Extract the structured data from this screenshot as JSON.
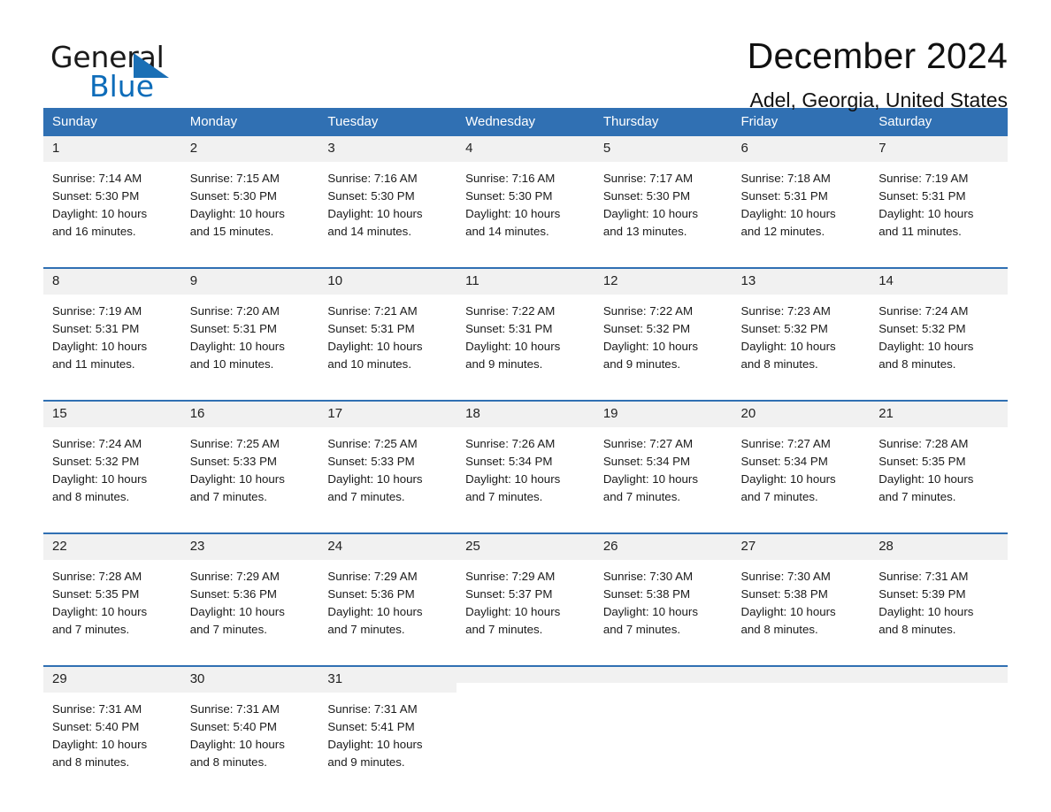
{
  "brand": {
    "word_one": "General",
    "word_two": "Blue",
    "triangle_color": "#1a6fb5",
    "blue_color": "#0d6cb9"
  },
  "header": {
    "title": "December 2024",
    "subtitle": "Adel, Georgia, United States",
    "accent_color": "#3070b3",
    "daynum_background": "#f1f1f1"
  },
  "calendar": {
    "weekday_headers": [
      "Sunday",
      "Monday",
      "Tuesday",
      "Wednesday",
      "Thursday",
      "Friday",
      "Saturday"
    ],
    "weeks": [
      [
        {
          "day": "1",
          "sunrise": "Sunrise: 7:14 AM",
          "sunset": "Sunset: 5:30 PM",
          "daylight_line1": "Daylight: 10 hours",
          "daylight_line2": "and 16 minutes."
        },
        {
          "day": "2",
          "sunrise": "Sunrise: 7:15 AM",
          "sunset": "Sunset: 5:30 PM",
          "daylight_line1": "Daylight: 10 hours",
          "daylight_line2": "and 15 minutes."
        },
        {
          "day": "3",
          "sunrise": "Sunrise: 7:16 AM",
          "sunset": "Sunset: 5:30 PM",
          "daylight_line1": "Daylight: 10 hours",
          "daylight_line2": "and 14 minutes."
        },
        {
          "day": "4",
          "sunrise": "Sunrise: 7:16 AM",
          "sunset": "Sunset: 5:30 PM",
          "daylight_line1": "Daylight: 10 hours",
          "daylight_line2": "and 14 minutes."
        },
        {
          "day": "5",
          "sunrise": "Sunrise: 7:17 AM",
          "sunset": "Sunset: 5:30 PM",
          "daylight_line1": "Daylight: 10 hours",
          "daylight_line2": "and 13 minutes."
        },
        {
          "day": "6",
          "sunrise": "Sunrise: 7:18 AM",
          "sunset": "Sunset: 5:31 PM",
          "daylight_line1": "Daylight: 10 hours",
          "daylight_line2": "and 12 minutes."
        },
        {
          "day": "7",
          "sunrise": "Sunrise: 7:19 AM",
          "sunset": "Sunset: 5:31 PM",
          "daylight_line1": "Daylight: 10 hours",
          "daylight_line2": "and 11 minutes."
        }
      ],
      [
        {
          "day": "8",
          "sunrise": "Sunrise: 7:19 AM",
          "sunset": "Sunset: 5:31 PM",
          "daylight_line1": "Daylight: 10 hours",
          "daylight_line2": "and 11 minutes."
        },
        {
          "day": "9",
          "sunrise": "Sunrise: 7:20 AM",
          "sunset": "Sunset: 5:31 PM",
          "daylight_line1": "Daylight: 10 hours",
          "daylight_line2": "and 10 minutes."
        },
        {
          "day": "10",
          "sunrise": "Sunrise: 7:21 AM",
          "sunset": "Sunset: 5:31 PM",
          "daylight_line1": "Daylight: 10 hours",
          "daylight_line2": "and 10 minutes."
        },
        {
          "day": "11",
          "sunrise": "Sunrise: 7:22 AM",
          "sunset": "Sunset: 5:31 PM",
          "daylight_line1": "Daylight: 10 hours",
          "daylight_line2": "and 9 minutes."
        },
        {
          "day": "12",
          "sunrise": "Sunrise: 7:22 AM",
          "sunset": "Sunset: 5:32 PM",
          "daylight_line1": "Daylight: 10 hours",
          "daylight_line2": "and 9 minutes."
        },
        {
          "day": "13",
          "sunrise": "Sunrise: 7:23 AM",
          "sunset": "Sunset: 5:32 PM",
          "daylight_line1": "Daylight: 10 hours",
          "daylight_line2": "and 8 minutes."
        },
        {
          "day": "14",
          "sunrise": "Sunrise: 7:24 AM",
          "sunset": "Sunset: 5:32 PM",
          "daylight_line1": "Daylight: 10 hours",
          "daylight_line2": "and 8 minutes."
        }
      ],
      [
        {
          "day": "15",
          "sunrise": "Sunrise: 7:24 AM",
          "sunset": "Sunset: 5:32 PM",
          "daylight_line1": "Daylight: 10 hours",
          "daylight_line2": "and 8 minutes."
        },
        {
          "day": "16",
          "sunrise": "Sunrise: 7:25 AM",
          "sunset": "Sunset: 5:33 PM",
          "daylight_line1": "Daylight: 10 hours",
          "daylight_line2": "and 7 minutes."
        },
        {
          "day": "17",
          "sunrise": "Sunrise: 7:25 AM",
          "sunset": "Sunset: 5:33 PM",
          "daylight_line1": "Daylight: 10 hours",
          "daylight_line2": "and 7 minutes."
        },
        {
          "day": "18",
          "sunrise": "Sunrise: 7:26 AM",
          "sunset": "Sunset: 5:34 PM",
          "daylight_line1": "Daylight: 10 hours",
          "daylight_line2": "and 7 minutes."
        },
        {
          "day": "19",
          "sunrise": "Sunrise: 7:27 AM",
          "sunset": "Sunset: 5:34 PM",
          "daylight_line1": "Daylight: 10 hours",
          "daylight_line2": "and 7 minutes."
        },
        {
          "day": "20",
          "sunrise": "Sunrise: 7:27 AM",
          "sunset": "Sunset: 5:34 PM",
          "daylight_line1": "Daylight: 10 hours",
          "daylight_line2": "and 7 minutes."
        },
        {
          "day": "21",
          "sunrise": "Sunrise: 7:28 AM",
          "sunset": "Sunset: 5:35 PM",
          "daylight_line1": "Daylight: 10 hours",
          "daylight_line2": "and 7 minutes."
        }
      ],
      [
        {
          "day": "22",
          "sunrise": "Sunrise: 7:28 AM",
          "sunset": "Sunset: 5:35 PM",
          "daylight_line1": "Daylight: 10 hours",
          "daylight_line2": "and 7 minutes."
        },
        {
          "day": "23",
          "sunrise": "Sunrise: 7:29 AM",
          "sunset": "Sunset: 5:36 PM",
          "daylight_line1": "Daylight: 10 hours",
          "daylight_line2": "and 7 minutes."
        },
        {
          "day": "24",
          "sunrise": "Sunrise: 7:29 AM",
          "sunset": "Sunset: 5:36 PM",
          "daylight_line1": "Daylight: 10 hours",
          "daylight_line2": "and 7 minutes."
        },
        {
          "day": "25",
          "sunrise": "Sunrise: 7:29 AM",
          "sunset": "Sunset: 5:37 PM",
          "daylight_line1": "Daylight: 10 hours",
          "daylight_line2": "and 7 minutes."
        },
        {
          "day": "26",
          "sunrise": "Sunrise: 7:30 AM",
          "sunset": "Sunset: 5:38 PM",
          "daylight_line1": "Daylight: 10 hours",
          "daylight_line2": "and 7 minutes."
        },
        {
          "day": "27",
          "sunrise": "Sunrise: 7:30 AM",
          "sunset": "Sunset: 5:38 PM",
          "daylight_line1": "Daylight: 10 hours",
          "daylight_line2": "and 8 minutes."
        },
        {
          "day": "28",
          "sunrise": "Sunrise: 7:31 AM",
          "sunset": "Sunset: 5:39 PM",
          "daylight_line1": "Daylight: 10 hours",
          "daylight_line2": "and 8 minutes."
        }
      ],
      [
        {
          "day": "29",
          "sunrise": "Sunrise: 7:31 AM",
          "sunset": "Sunset: 5:40 PM",
          "daylight_line1": "Daylight: 10 hours",
          "daylight_line2": "and 8 minutes."
        },
        {
          "day": "30",
          "sunrise": "Sunrise: 7:31 AM",
          "sunset": "Sunset: 5:40 PM",
          "daylight_line1": "Daylight: 10 hours",
          "daylight_line2": "and 8 minutes."
        },
        {
          "day": "31",
          "sunrise": "Sunrise: 7:31 AM",
          "sunset": "Sunset: 5:41 PM",
          "daylight_line1": "Daylight: 10 hours",
          "daylight_line2": "and 9 minutes."
        },
        {
          "day": "",
          "sunrise": "",
          "sunset": "",
          "daylight_line1": "",
          "daylight_line2": ""
        },
        {
          "day": "",
          "sunrise": "",
          "sunset": "",
          "daylight_line1": "",
          "daylight_line2": ""
        },
        {
          "day": "",
          "sunrise": "",
          "sunset": "",
          "daylight_line1": "",
          "daylight_line2": ""
        },
        {
          "day": "",
          "sunrise": "",
          "sunset": "",
          "daylight_line1": "",
          "daylight_line2": ""
        }
      ]
    ]
  }
}
